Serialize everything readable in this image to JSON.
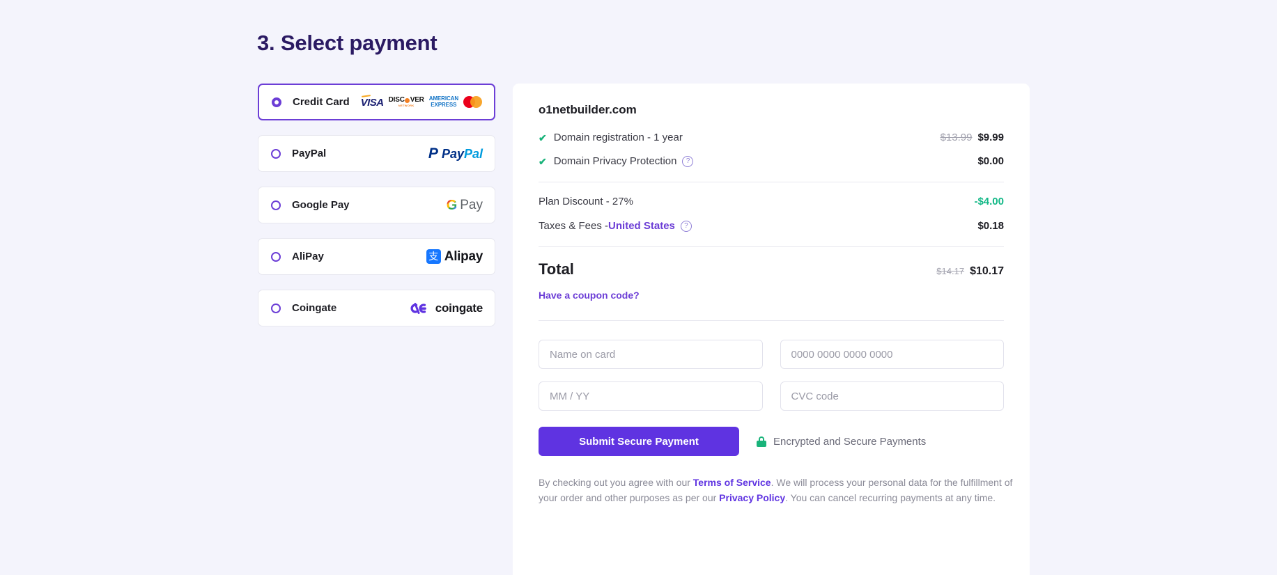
{
  "page": {
    "title": "3. Select payment",
    "accent": "#6c3ed6",
    "button_color": "#5f33e1",
    "background": "#f4f4fc"
  },
  "payment_methods": [
    {
      "label": "Credit Card",
      "selected": true,
      "logo": "card-brands"
    },
    {
      "label": "PayPal",
      "selected": false,
      "logo": "paypal-logo"
    },
    {
      "label": "Google Pay",
      "selected": false,
      "logo": "google-pay-logo"
    },
    {
      "label": "AliPay",
      "selected": false,
      "logo": "alipay-logo"
    },
    {
      "label": "Coingate",
      "selected": false,
      "logo": "coingate-logo"
    }
  ],
  "card_brands": [
    {
      "name": "VISA"
    },
    {
      "name": "DISCOVER",
      "sub": "NETWORK"
    },
    {
      "name": "AMERICAN",
      "sub": "EXPRESS"
    },
    {
      "name": "Mastercard"
    }
  ],
  "logos": {
    "paypal_p": "P",
    "paypal_pay": "Pay",
    "paypal_pal": "Pal",
    "google_g": "G",
    "google_pay": "Pay",
    "alipay_mark": "支",
    "alipay_text": "Alipay",
    "coingate_text": "coingate"
  },
  "summary": {
    "domain": "o1netbuilder.com",
    "items": [
      {
        "label": "Domain registration - 1 year",
        "old_price": "$13.99",
        "price": "$9.99",
        "has_help": false
      },
      {
        "label": "Domain Privacy Protection",
        "old_price": "",
        "price": "$0.00",
        "has_help": true
      }
    ],
    "adjustments": [
      {
        "label": "Plan Discount - 27%",
        "amount": "-$4.00",
        "negative": true
      },
      {
        "label": "Taxes & Fees - ",
        "link": "United States",
        "amount": "$0.18",
        "negative": false,
        "has_help": true
      }
    ],
    "total_label": "Total",
    "total_old": "$14.17",
    "total": "$10.17",
    "coupon_label": "Have a coupon code?"
  },
  "card_form": {
    "name_placeholder": "Name on card",
    "number_placeholder": "0000 0000 0000 0000",
    "expiry_placeholder": "MM / YY",
    "cvc_placeholder": "CVC code",
    "name_value": "",
    "number_value": "",
    "expiry_value": "",
    "cvc_value": "",
    "submit_label": "Submit Secure Payment",
    "secure_note": "Encrypted and Secure Payments"
  },
  "terms": {
    "part1": "By checking out you agree with our ",
    "link1": "Terms of Service",
    "part2": ". We will process your personal data for the fulfillment of your order and other purposes as per our ",
    "link2": "Privacy Policy",
    "part3": ". You can cancel recurring payments at any time."
  }
}
